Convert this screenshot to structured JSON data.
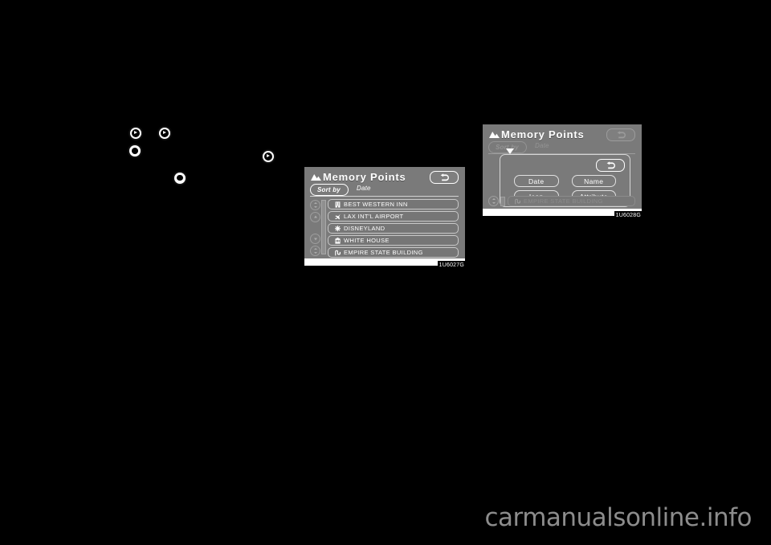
{
  "page": {
    "background_color": "#000000",
    "watermark": "carmanualsonline.info"
  },
  "redacted_bullets": [
    {
      "name": "bullet-icon-1",
      "icon": "circle-play-icon"
    },
    {
      "name": "bullet-icon-2",
      "icon": "circle-play-icon"
    },
    {
      "name": "bullet-icon-3",
      "icon": "circle-oval-icon"
    },
    {
      "name": "bullet-icon-4",
      "icon": "circle-oval-icon"
    },
    {
      "name": "bullet-icon-5",
      "icon": "circle-play-icon"
    }
  ],
  "figure_1": {
    "code": "1U6027G",
    "screen": {
      "title": "Memory Points",
      "title_icon": "mountain-icon",
      "back_button_icon": "back-arrow-icon",
      "sort_by_tab": "Sort by",
      "sort_tab_label": "Date",
      "scroll_buttons": [
        "scroll-both",
        "scroll-up",
        "scroll-down",
        "scroll-both"
      ],
      "items": [
        {
          "label": "BEST WESTERN INN",
          "icon": "hotel-icon"
        },
        {
          "label": "LAX INT'L  AIRPORT",
          "icon": "airport-icon"
        },
        {
          "label": "DISNEYLAND",
          "icon": "amusement-park-icon"
        },
        {
          "label": "WHITE HOUSE",
          "icon": "government-building-icon"
        },
        {
          "label": "EMPIRE STATE BUILDING",
          "icon": "landmark-icon"
        }
      ]
    }
  },
  "figure_2": {
    "code": "1U6028G",
    "screen": {
      "title": "Memory Points",
      "title_icon": "mountain-icon",
      "back_button_icon": "back-arrow-icon",
      "sort_by_tab": "Sort by",
      "sort_tab_label": "Date",
      "dialog": {
        "back_button_icon": "back-arrow-icon",
        "options": [
          {
            "label": "Date"
          },
          {
            "label": "Name"
          },
          {
            "label": "Icon"
          },
          {
            "label": "Attribute"
          }
        ]
      },
      "background_item": {
        "label": "EMPIRE STATE BUILDING",
        "icon": "landmark-icon"
      }
    }
  }
}
